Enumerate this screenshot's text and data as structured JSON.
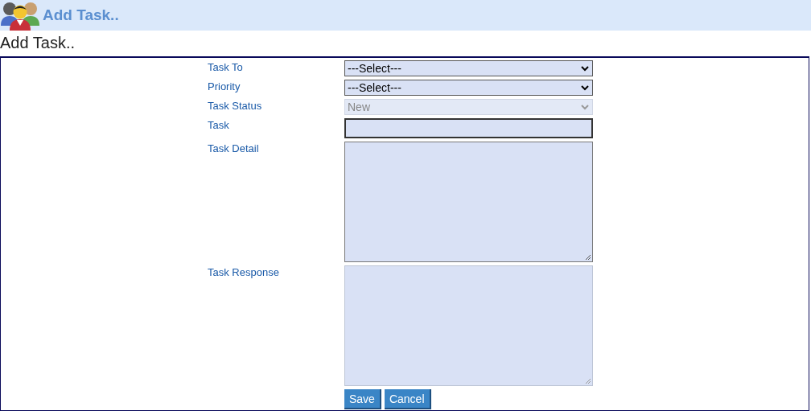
{
  "header": {
    "title": "Add Task.."
  },
  "page_title": "Add Task..",
  "form": {
    "fields": [
      {
        "label": "Task To",
        "kind": "select",
        "value": "---Select---",
        "disabled": false
      },
      {
        "label": "Priority",
        "kind": "select",
        "value": "---Select---",
        "disabled": false
      },
      {
        "label": "Task Status",
        "kind": "select",
        "value": "New",
        "disabled": true
      },
      {
        "label": "Task",
        "kind": "text",
        "disabled": false,
        "focused": true
      },
      {
        "label": "Task Detail",
        "kind": "textarea",
        "disabled": false
      },
      {
        "label": "Task Response",
        "kind": "textarea",
        "disabled": true
      }
    ],
    "buttons": [
      "Save",
      "Cancel"
    ]
  }
}
